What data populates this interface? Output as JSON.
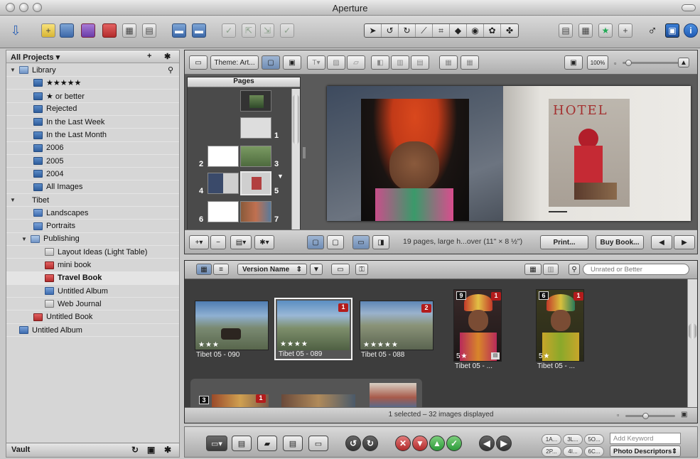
{
  "window": {
    "title": "Aperture"
  },
  "left_panel": {
    "header": "All Projects",
    "header_add": "+",
    "header_action": "✱",
    "items": [
      {
        "label": "Library",
        "type": "folder"
      },
      {
        "label": "★★★★★",
        "type": "smart"
      },
      {
        "label": "★ or better",
        "type": "smart"
      },
      {
        "label": "Rejected",
        "type": "smart"
      },
      {
        "label": "In the Last Week",
        "type": "smart"
      },
      {
        "label": "In the Last Month",
        "type": "smart"
      },
      {
        "label": "2006",
        "type": "smart"
      },
      {
        "label": "2005",
        "type": "smart"
      },
      {
        "label": "2004",
        "type": "smart"
      },
      {
        "label": "All Images",
        "type": "smart"
      },
      {
        "label": "Tibet",
        "type": "project"
      },
      {
        "label": "Landscapes",
        "type": "album"
      },
      {
        "label": "Portraits",
        "type": "album"
      },
      {
        "label": "Publishing",
        "type": "folder"
      },
      {
        "label": "Layout Ideas (Light Table)",
        "type": "web"
      },
      {
        "label": "mini book",
        "type": "book"
      },
      {
        "label": "Travel Book",
        "type": "book",
        "selected": true
      },
      {
        "label": "Untitled Album",
        "type": "album"
      },
      {
        "label": "Web Journal",
        "type": "web"
      },
      {
        "label": "Untitled Book",
        "type": "book"
      },
      {
        "label": "Untitled Album",
        "type": "album"
      }
    ],
    "footer": "Vault"
  },
  "book_panel": {
    "theme_label": "Theme: Art...",
    "zoom": "100%",
    "pages_header": "Pages",
    "page_numbers": [
      "1",
      "2",
      "3",
      "4",
      "5",
      "6",
      "7"
    ],
    "status": "19 pages, large h...over (11\" × 8 ½\")",
    "print_button": "Print...",
    "buy_button": "Buy Book...",
    "hotel_sign": "HOTEL"
  },
  "browser_panel": {
    "sort_field": "Version Name",
    "search_placeholder": "Unrated or Better",
    "status": "1 selected – 32 images displayed",
    "photos": [
      {
        "caption": "Tibet 05 -   090",
        "stars": "★★★",
        "badge": ""
      },
      {
        "caption": "Tibet 05 -   089",
        "stars": "★★★★",
        "badge": "1"
      },
      {
        "caption": "Tibet 05 -   088",
        "stars": "★★★★★",
        "badge": "2"
      },
      {
        "caption": "Tibet 05 -   ...",
        "stars": "5★",
        "badge": "1",
        "stack": "9"
      },
      {
        "caption": "Tibet 05 -   ...",
        "stars": "5★",
        "badge": "1",
        "stack": "6"
      }
    ],
    "stack_row_count": "3",
    "stack_row_badge": "1"
  },
  "control_bar": {
    "keyword_buttons": [
      "1A...",
      "3L...",
      "5O...",
      "2P...",
      "4I...",
      "6C..."
    ],
    "keyword_placeholder": "Add Keyword",
    "keyword_set": "Photo Descriptors"
  }
}
